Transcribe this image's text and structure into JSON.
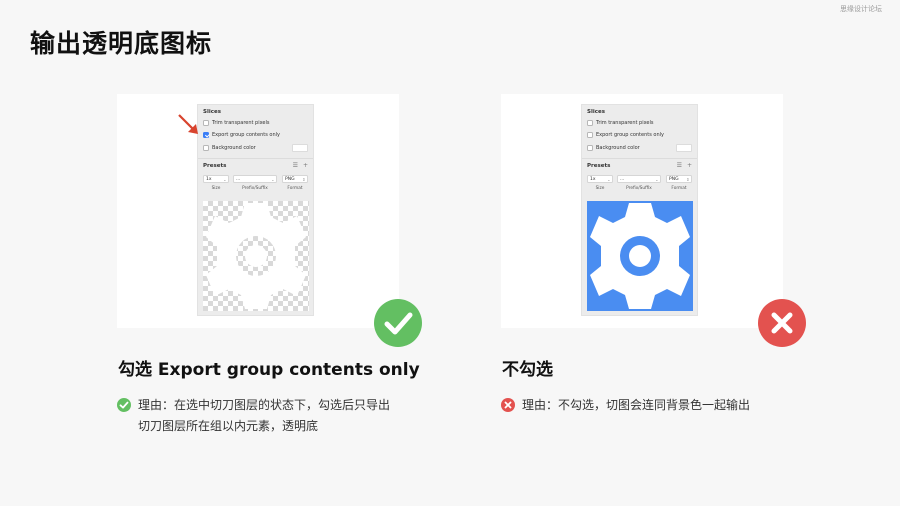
{
  "watermark": "思缘设计论坛",
  "title": "输出透明底图标",
  "panel": {
    "slices_title": "Slices",
    "trim_label": "Trim transparent pixels",
    "export_group_label": "Export group contents only",
    "background_label": "Background color",
    "presets_title": "Presets",
    "size_value": "1x",
    "prefix_value": "...",
    "format_value": "PNG",
    "size_label": "Size",
    "prefix_label": "Prefix/Suffix",
    "format_label": "Format"
  },
  "left": {
    "export_group_checked": true,
    "caption": "勾选 Export group contents only",
    "reason": "理由：在选中切刀图层的状态下，勾选后只导出切刀图层所在组以内元素，透明底"
  },
  "right": {
    "export_group_checked": false,
    "caption": "不勾选",
    "reason": "理由：不勾选，切图会连同背景色一起输出"
  },
  "colors": {
    "ok": "#63bf62",
    "no": "#e3524f",
    "icon_bg": "#4a8df1",
    "arrow": "#d8442e",
    "checkbox": "#3b7ef6"
  },
  "icons": [
    "gear-icon",
    "check-icon",
    "close-icon",
    "red-arrow"
  ]
}
